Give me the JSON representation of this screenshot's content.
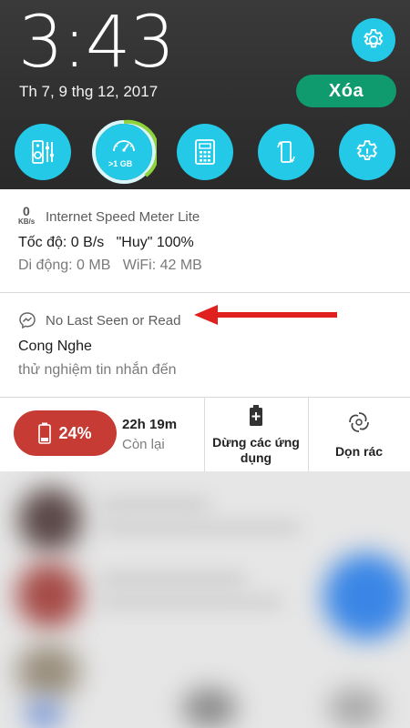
{
  "status": {
    "time": "3:43",
    "date": "Th 7, 9 thg 12, 2017",
    "clear_label": "Xóa"
  },
  "quick_settings": [
    {
      "icon": "speaker-equalizer-icon"
    },
    {
      "icon": "speed-booster-icon",
      "badge": ">1 GB"
    },
    {
      "icon": "calculator-icon"
    },
    {
      "icon": "auto-rotate-icon"
    },
    {
      "icon": "settings-gear-icon"
    }
  ],
  "speed_notification": {
    "icon_value": "0",
    "icon_unit": "KB/s",
    "app_name": "Internet Speed Meter Lite",
    "line1": "Tốc độ: 0 B/s   \"Huy\" 100%",
    "line2": "Di động: 0 MB   WiFi: 42 MB"
  },
  "message_notification": {
    "app_name": "No Last Seen or Read",
    "title": "Cong Nghe",
    "text": "thử nghiệm tin nhắn đến"
  },
  "battery_widget": {
    "percent": "24%",
    "remaining_time": "22h 19m",
    "remaining_label": "Còn lại",
    "stop_apps_label": "Dừng các ứng dụng",
    "cleaner_label": "Dọn rác"
  },
  "colors": {
    "accent_cyan": "#23c9e6",
    "clear_green": "#0f9b6e",
    "battery_red": "#c63b34",
    "arrow_red": "#e01f1f"
  }
}
